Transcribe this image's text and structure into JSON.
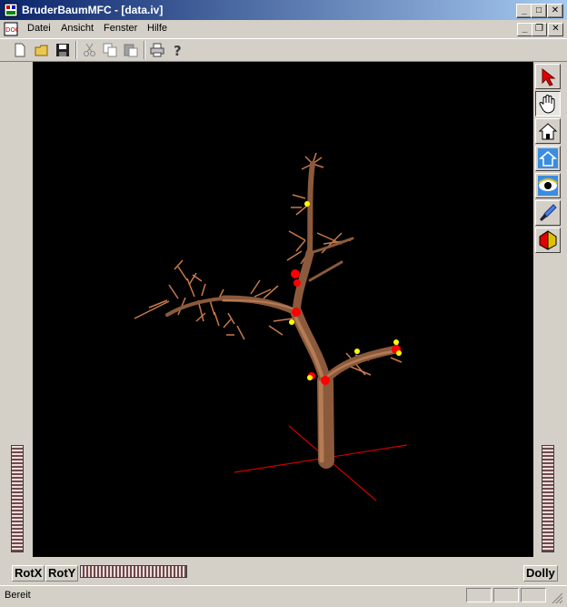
{
  "window": {
    "title": "BruderBaumMFC - [data.iv]"
  },
  "menu": {
    "items": [
      "Datei",
      "Ansicht",
      "Fenster",
      "Hilfe"
    ]
  },
  "caption_buttons": {
    "minimize": "_",
    "maximize": "□",
    "close": "✕"
  },
  "mdi_buttons": {
    "minimize": "_",
    "restore": "❐",
    "close": "✕"
  },
  "viewer": {
    "background": "#000000",
    "trunk_color": "#8b5a3c",
    "branch_color": "#c87a4a",
    "node_color": "#ff0000",
    "marker_color": "#ffff00",
    "axis_color": "#cc0000"
  },
  "tools": [
    "pick-arrow",
    "hand-view",
    "home",
    "set-home",
    "view-all",
    "seek",
    "perspective"
  ],
  "wheels": {
    "rotx": "RotX",
    "roty": "RotY",
    "dolly": "Dolly"
  },
  "status": {
    "text": "Bereit"
  }
}
